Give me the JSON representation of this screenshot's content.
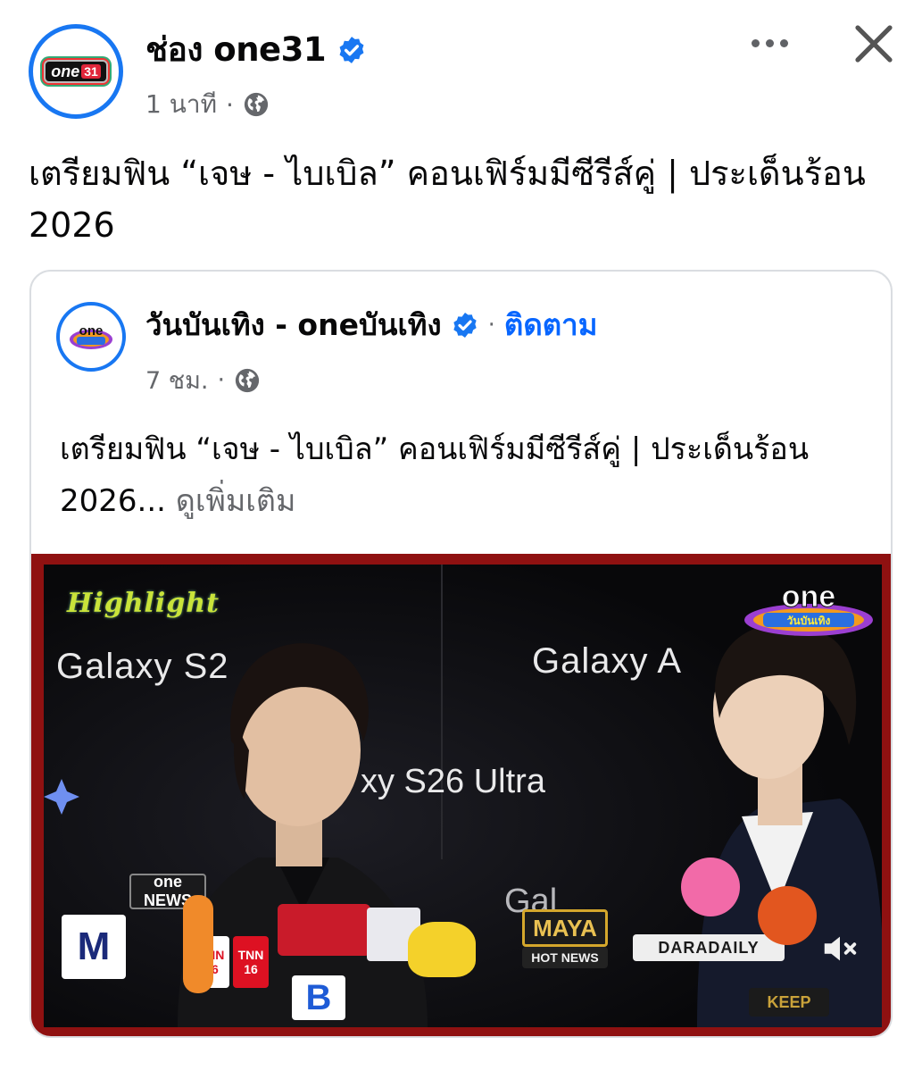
{
  "post": {
    "page_name": "ช่อง one31",
    "time": "1 นาที",
    "dot": "·",
    "text": "เตรียมฟิน “เจษ - ไบเบิล” คอนเฟิร์มมีซีรีส์คู่  | ประเด็นร้อน 2026",
    "avatar_logo_text": "one",
    "avatar_logo_num": "31"
  },
  "shared": {
    "page_name": "วันบันเทิง - oneบันเทิง",
    "dot": "·",
    "follow_label": "ติดตาม",
    "time": "7 ชม.",
    "text": "เตรียมฟิน “เจษ - ไบเบิล” คอนเฟิร์มมีซีรีส์คู่  | ประเด็นร้อน 2026...",
    "see_more": "ดูเพิ่มเติม"
  },
  "video": {
    "highlight_label": "Highlight",
    "backdrop_text_1": "Galaxy S2",
    "backdrop_text_2": "Galaxy A",
    "backdrop_text_3": "xy S26 Ultra",
    "backdrop_text_4": "Gal",
    "corner_logo_top": "one",
    "corner_logo_bottom": "วันบันเทิง",
    "mics": {
      "one_news": "one NEWS",
      "tnn1": "TNN 16",
      "tnn2": "TNN 16",
      "maya": "MAYA",
      "hot_news": "HOT NEWS",
      "daradaily": "DARADAILY",
      "m": "M",
      "b": "B",
      "keep": "KEEP"
    }
  },
  "colors": {
    "accent": "#1877f2",
    "link": "#0866ff",
    "meta_gray": "#65676b",
    "video_border": "#8f1111"
  },
  "icons": [
    "verified-badge-icon",
    "globe-icon",
    "more-options-icon",
    "close-icon",
    "mute-icon"
  ]
}
